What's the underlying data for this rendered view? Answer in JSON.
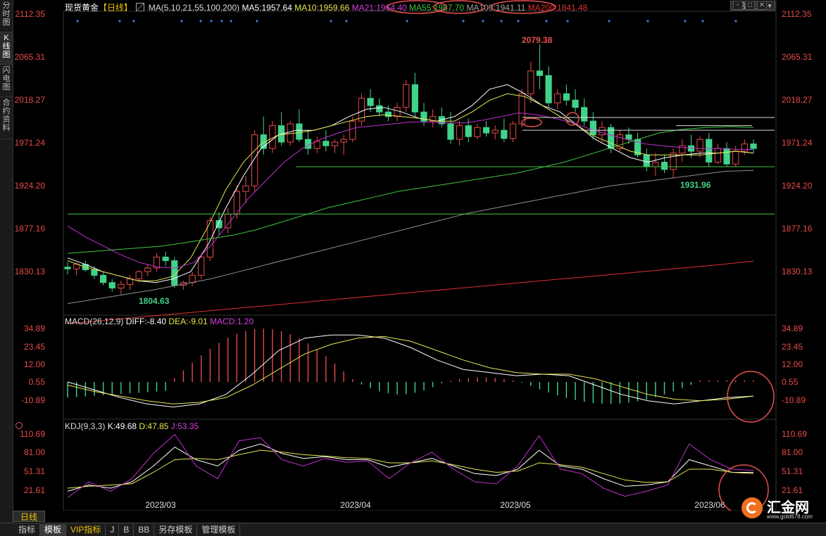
{
  "left_tabs": [
    "分时图",
    "K线图",
    "闪电图",
    "合约资料"
  ],
  "header": {
    "symbol": "现货黄金",
    "period": "【日线】",
    "ma_label": "MA(5,10,21,55,100,200)",
    "ma5": "MA5:1957.64",
    "ma10": "MA10:1959.66",
    "ma21": "MA21:1964.40",
    "ma55": "MA55:1987.70",
    "ma100": "MA100:1941.11",
    "ma200": "MA200:1841.48",
    "theme": "全部主题"
  },
  "colors": {
    "up": "#e84a4a",
    "down": "#40d38a",
    "ma5": "#ffffff",
    "ma10": "#e6e650",
    "ma21": "#c030d0",
    "ma55": "#3ec83e",
    "ma100": "#909090",
    "ma200": "#e03030",
    "annot": "#e85050"
  },
  "price_axis": [
    "2112.35",
    "2065.31",
    "2018.27",
    "1971.24",
    "1924.20",
    "1877.16",
    "1830.13"
  ],
  "price_marks": {
    "high": "2079.38",
    "low1": "1804.63",
    "low2": "1931.96"
  },
  "macd": {
    "label": "MACD(26,12,9)",
    "diff": "DIFF:-8.40",
    "dea": "DEA:-9.01",
    "macd": "MACD:1.20",
    "axis": [
      "34.89",
      "23.45",
      "12.00",
      "0.55",
      "-10.89"
    ]
  },
  "kdj": {
    "label": "KDJ(9,3,3)",
    "k": "K:49.68",
    "d": "D:47.85",
    "j": "J:53.35",
    "axis": [
      "110.69",
      "81.00",
      "51.31",
      "21.61"
    ]
  },
  "x_dates": [
    "2023/03",
    "2023/04",
    "2023/05",
    "2023/06"
  ],
  "period_button": "日线",
  "bottom_tabs": [
    "指标",
    "模板",
    "VIP指标",
    "J",
    "B",
    "BB",
    "另存模板",
    "管理模板"
  ],
  "logo": {
    "name": "汇金网",
    "url": "www.gold678.com"
  }
}
